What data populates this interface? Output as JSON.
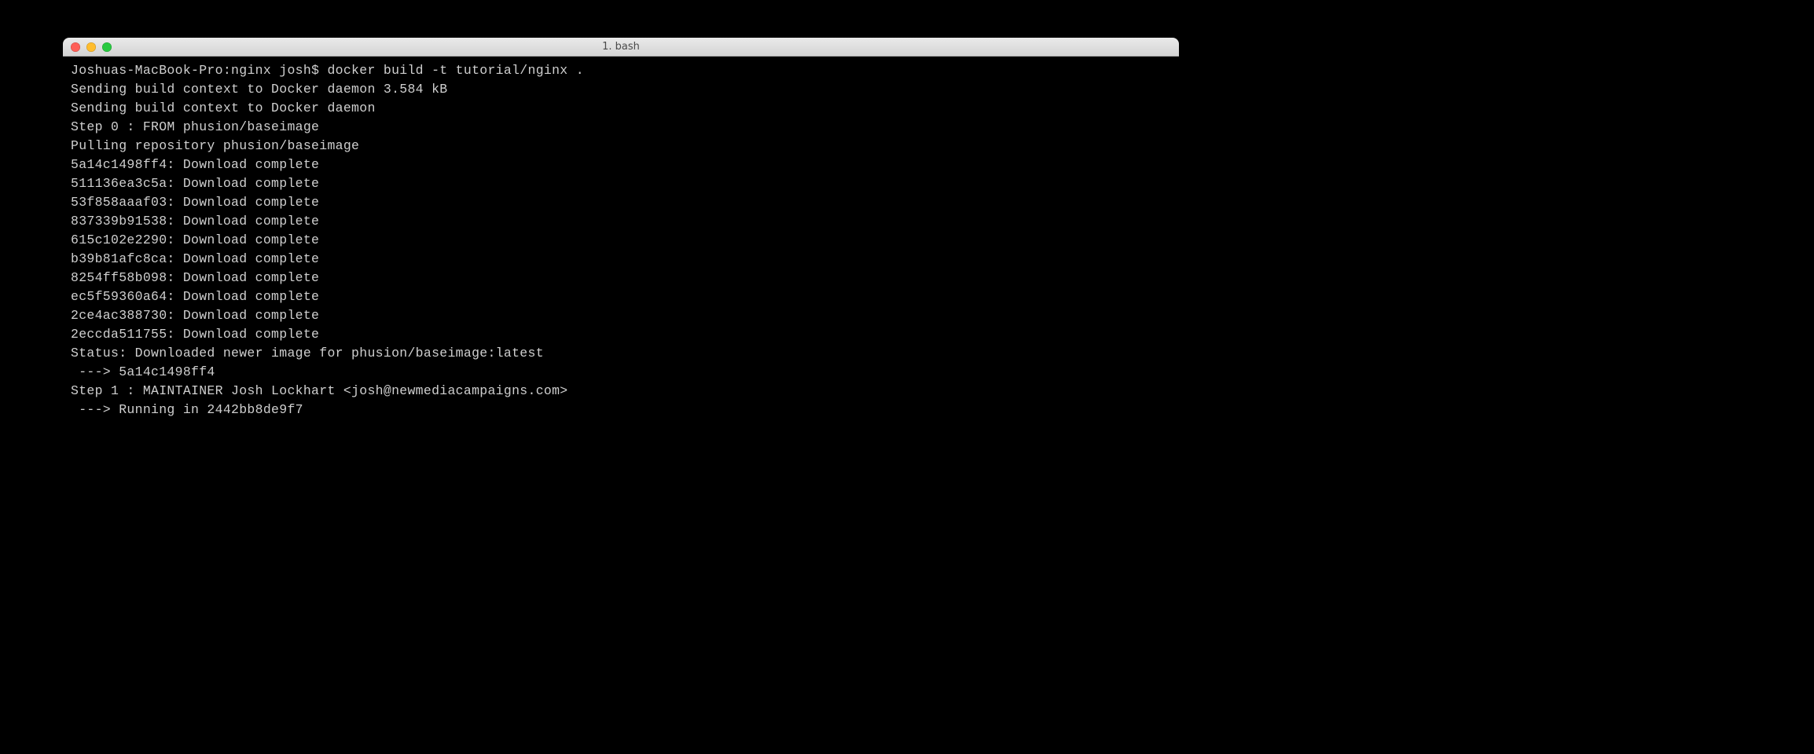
{
  "window": {
    "title": "1. bash"
  },
  "term": {
    "prompt": "Joshuas-MacBook-Pro:nginx josh$ ",
    "command": "docker build -t tutorial/nginx .",
    "lines": [
      "Sending build context to Docker daemon 3.584 kB",
      "Sending build context to Docker daemon ",
      "Step 0 : FROM phusion/baseimage",
      "Pulling repository phusion/baseimage",
      "5a14c1498ff4: Download complete ",
      "511136ea3c5a: Download complete ",
      "53f858aaaf03: Download complete ",
      "837339b91538: Download complete ",
      "615c102e2290: Download complete ",
      "b39b81afc8ca: Download complete ",
      "8254ff58b098: Download complete ",
      "ec5f59360a64: Download complete ",
      "2ce4ac388730: Download complete ",
      "2eccda511755: Download complete ",
      "Status: Downloaded newer image for phusion/baseimage:latest",
      " ---> 5a14c1498ff4",
      "Step 1 : MAINTAINER Josh Lockhart <josh@newmediacampaigns.com>",
      " ---> Running in 2442bb8de9f7"
    ]
  }
}
